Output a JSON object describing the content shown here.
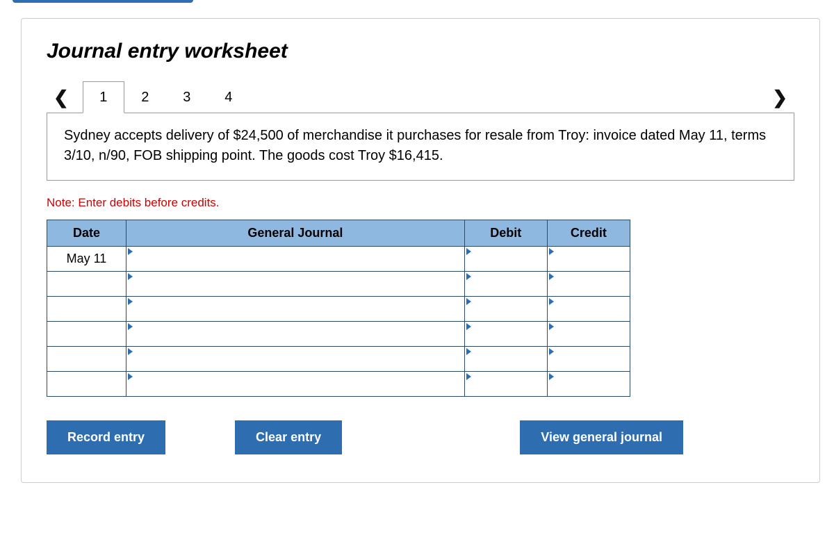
{
  "title": "Journal entry worksheet",
  "nav": {
    "prev": "<",
    "next": ">"
  },
  "tabs": [
    "1",
    "2",
    "3",
    "4"
  ],
  "active_tab_index": 0,
  "description": "Sydney accepts delivery of $24,500 of merchandise it purchases for resale from Troy: invoice dated May 11, terms 3/10, n/90, FOB shipping point. The goods cost Troy $16,415.",
  "note": "Note: Enter debits before credits.",
  "table": {
    "headers": {
      "date": "Date",
      "gj": "General Journal",
      "debit": "Debit",
      "credit": "Credit"
    },
    "rows": [
      {
        "date": "May 11",
        "gj": "",
        "debit": "",
        "credit": ""
      },
      {
        "date": "",
        "gj": "",
        "debit": "",
        "credit": ""
      },
      {
        "date": "",
        "gj": "",
        "debit": "",
        "credit": ""
      },
      {
        "date": "",
        "gj": "",
        "debit": "",
        "credit": ""
      },
      {
        "date": "",
        "gj": "",
        "debit": "",
        "credit": ""
      },
      {
        "date": "",
        "gj": "",
        "debit": "",
        "credit": ""
      }
    ]
  },
  "buttons": {
    "record": "Record entry",
    "clear": "Clear entry",
    "view": "View general journal"
  }
}
